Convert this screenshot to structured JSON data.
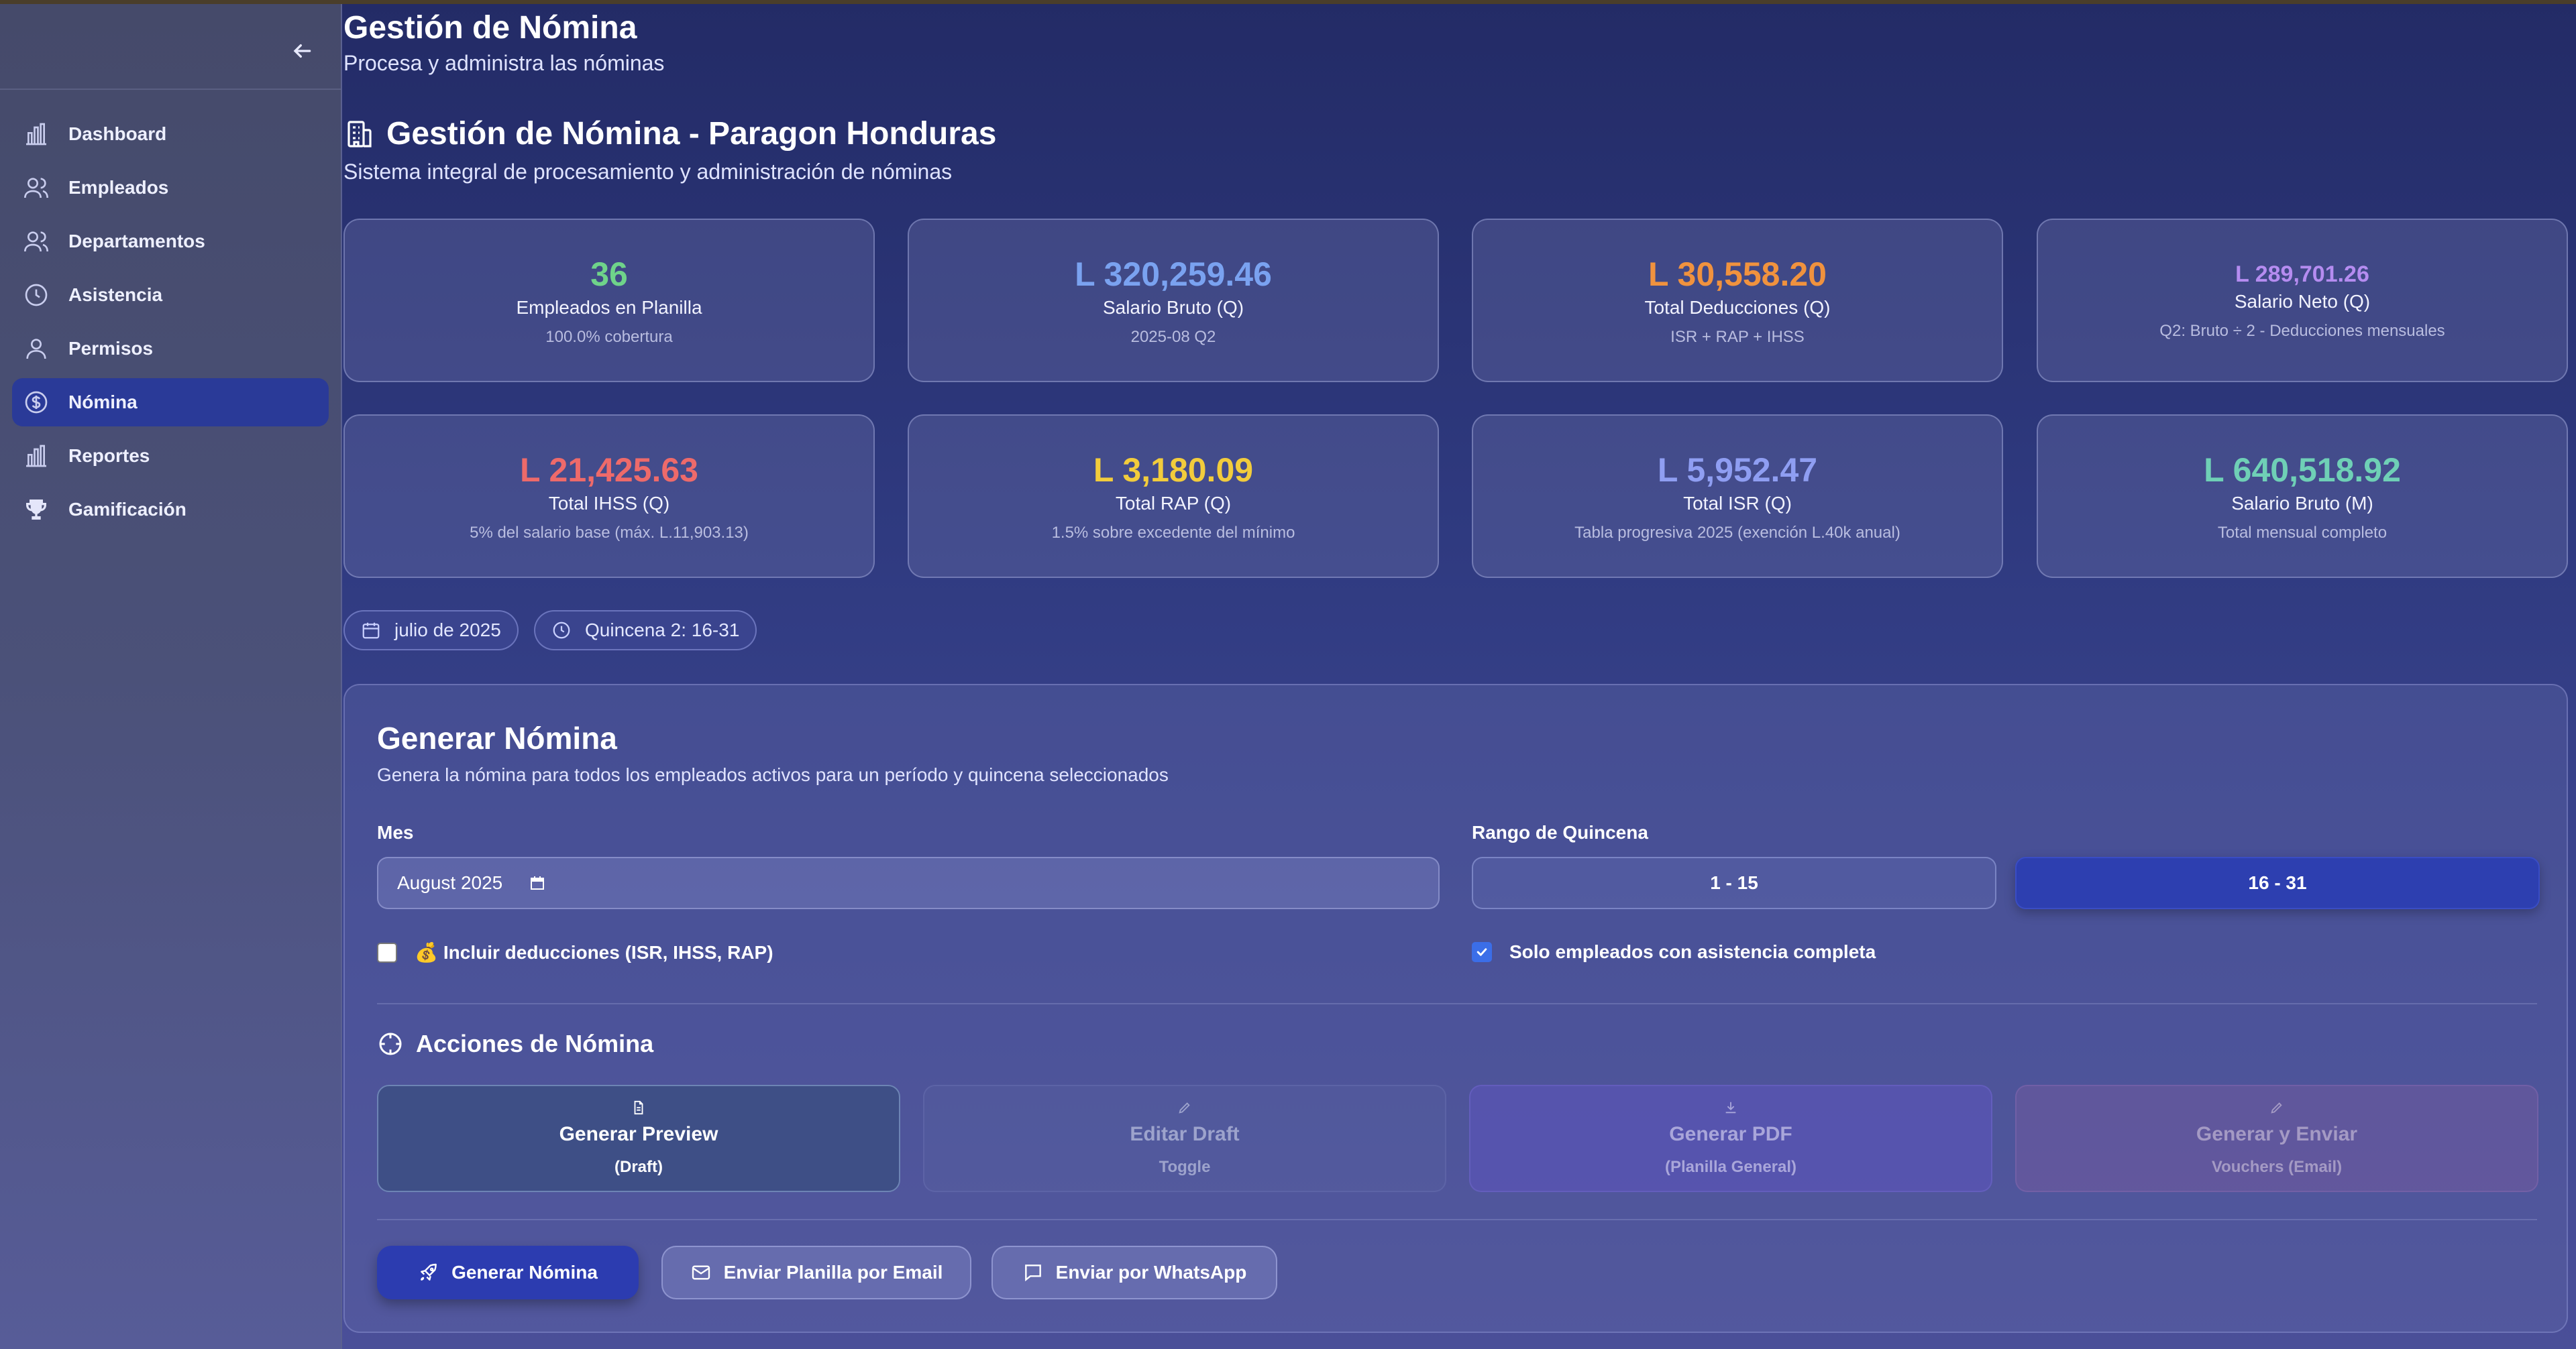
{
  "sidebar": {
    "items": [
      {
        "label": "Dashboard",
        "icon": "bar-chart-icon"
      },
      {
        "label": "Empleados",
        "icon": "users-icon"
      },
      {
        "label": "Departamentos",
        "icon": "users-icon"
      },
      {
        "label": "Asistencia",
        "icon": "clock-icon"
      },
      {
        "label": "Permisos",
        "icon": "user-icon"
      },
      {
        "label": "Nómina",
        "icon": "dollar-circle-icon",
        "active": true
      },
      {
        "label": "Reportes",
        "icon": "bar-chart-icon"
      },
      {
        "label": "Gamificación",
        "icon": "trophy-icon"
      }
    ]
  },
  "header": {
    "title": "Gestión de Nómina",
    "subtitle": "Procesa y administra las nóminas"
  },
  "section": {
    "title": "Gestión de Nómina - Paragon Honduras",
    "subtitle": "Sistema integral de procesamiento y administración de nóminas"
  },
  "stats": [
    {
      "value": "36",
      "label": "Empleados en Planilla",
      "note": "100.0% cobertura",
      "color": "#6fd38a"
    },
    {
      "value": "L 320,259.46",
      "label": "Salario Bruto (Q)",
      "note": "2025-08 Q2",
      "color": "#7aa2f0"
    },
    {
      "value": "L 30,558.20",
      "label": "Total Deducciones (Q)",
      "note": "ISR + RAP + IHSS",
      "color": "#f0923e"
    },
    {
      "value": "L 289,701.26",
      "label": "Salario Neto (Q)",
      "note": "Q2: Bruto ÷ 2 - Deducciones mensuales",
      "color": "#b58cf0"
    },
    {
      "value": "L 21,425.63",
      "label": "Total IHSS (Q)",
      "note": "5% del salario base (máx. L.11,903.13)",
      "color": "#ee6a6a"
    },
    {
      "value": "L 3,180.09",
      "label": "Total RAP (Q)",
      "note": "1.5% sobre excedente del mínimo",
      "color": "#f2cc3c"
    },
    {
      "value": "L 5,952.47",
      "label": "Total ISR (Q)",
      "note": "Tabla progresiva 2025 (exención L.40k anual)",
      "color": "#8f9ef2"
    },
    {
      "value": "L 640,518.92",
      "label": "Salario Bruto (M)",
      "note": "Total mensual completo",
      "color": "#6fd0b6"
    }
  ],
  "chips": {
    "period": "julio de 2025",
    "quincena": "Quincena 2: 16-31"
  },
  "form": {
    "title": "Generar Nómina",
    "description": "Genera la nómina para todos los empleados activos para un período y quincena seleccionados",
    "month_label": "Mes",
    "month_value": "August  2025",
    "range_label": "Rango de Quincena",
    "range_options": [
      "1 - 15",
      "16 - 31"
    ],
    "range_selected": "16 - 31",
    "include_deductions_label": "Incluir deducciones (ISR, IHSS, RAP)",
    "include_deductions_checked": false,
    "only_full_attendance_label": "Solo empleados con asistencia completa",
    "only_full_attendance_checked": true
  },
  "actions": {
    "title": "Acciones de Nómina",
    "cards": [
      {
        "title": "Generar Preview",
        "subtitle": "(Draft)",
        "icon": "file-icon"
      },
      {
        "title": "Editar Draft",
        "subtitle": "Toggle",
        "icon": "pencil-icon"
      },
      {
        "title": "Generar PDF",
        "subtitle": "(Planilla General)",
        "icon": "download-icon"
      },
      {
        "title": "Generar y Enviar",
        "subtitle": "Vouchers (Email)",
        "icon": "pencil-icon"
      }
    ]
  },
  "buttons": {
    "generate": "Generar Nómina",
    "email": "Enviar Planilla por Email",
    "whatsapp": "Enviar por WhatsApp"
  }
}
